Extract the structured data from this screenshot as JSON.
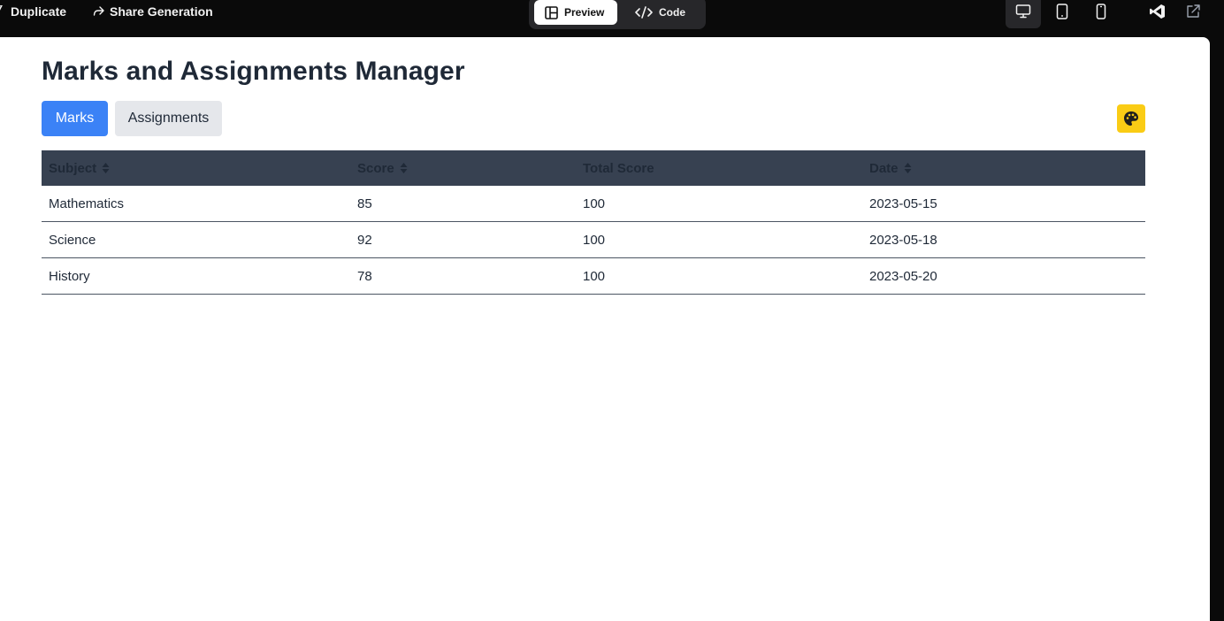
{
  "topbar": {
    "duplicate_label": "Duplicate",
    "share_label": "Share Generation",
    "preview_label": "Preview",
    "code_label": "Code"
  },
  "page": {
    "title": "Marks and Assignments Manager",
    "tabs": [
      {
        "label": "Marks",
        "active": true
      },
      {
        "label": "Assignments",
        "active": false
      }
    ],
    "theme_icon": "palette-icon"
  },
  "table": {
    "headers": [
      "Subject",
      "Score",
      "Total Score",
      "Date"
    ],
    "sortable": [
      true,
      true,
      false,
      true
    ],
    "rows": [
      [
        "Mathematics",
        "85",
        "100",
        "2023-05-15"
      ],
      [
        "Science",
        "92",
        "100",
        "2023-05-18"
      ],
      [
        "History",
        "78",
        "100",
        "2023-05-20"
      ]
    ]
  },
  "colors": {
    "primary": "#3b82f6",
    "header_bg": "#374151",
    "accent_yellow": "#facc15",
    "text": "#1f2937"
  }
}
